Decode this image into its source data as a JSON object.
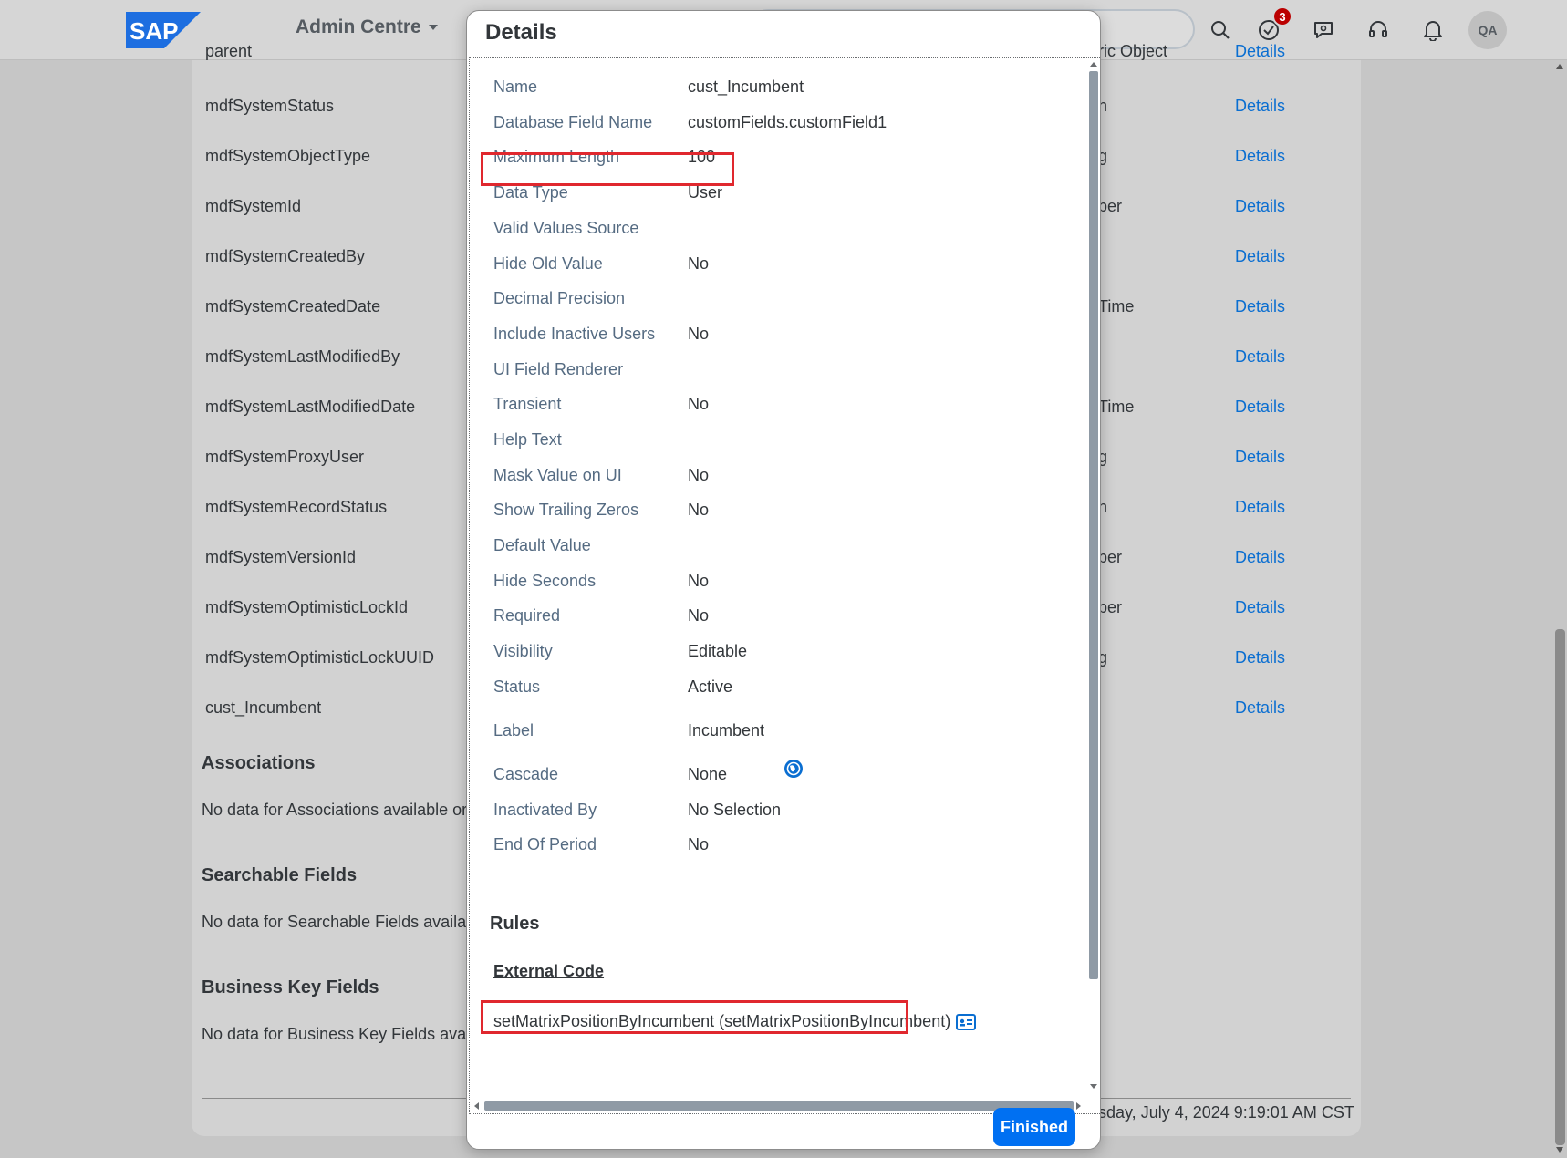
{
  "shell": {
    "logo_text": "SAP",
    "app_title": "Admin Centre",
    "notification_count": "3",
    "avatar_initials": "QA"
  },
  "background": {
    "partial_top_label": "parent",
    "partial_top_type": "ric Object",
    "fields": [
      {
        "name": "mdfSystemStatus",
        "type": "n",
        "link": "Details"
      },
      {
        "name": "mdfSystemObjectType",
        "type": "g",
        "link": "Details"
      },
      {
        "name": "mdfSystemId",
        "type": "ber",
        "link": "Details"
      },
      {
        "name": "mdfSystemCreatedBy",
        "type": "",
        "link": "Details"
      },
      {
        "name": "mdfSystemCreatedDate",
        "type": "Time",
        "link": "Details"
      },
      {
        "name": "mdfSystemLastModifiedBy",
        "type": "",
        "link": "Details"
      },
      {
        "name": "mdfSystemLastModifiedDate",
        "type": "Time",
        "link": "Details"
      },
      {
        "name": "mdfSystemProxyUser",
        "type": "g",
        "link": "Details"
      },
      {
        "name": "mdfSystemRecordStatus",
        "type": "n",
        "link": "Details"
      },
      {
        "name": "mdfSystemVersionId",
        "type": "ber",
        "link": "Details"
      },
      {
        "name": "mdfSystemOptimisticLockId",
        "type": "ber",
        "link": "Details"
      },
      {
        "name": "mdfSystemOptimisticLockUUID",
        "type": "g",
        "link": "Details"
      },
      {
        "name": "cust_Incumbent",
        "type": "",
        "link": "Details"
      }
    ],
    "sections": [
      {
        "title": "Associations",
        "text": "No data for Associations available or y"
      },
      {
        "title": "Searchable Fields",
        "text": "No data for Searchable Fields availab"
      },
      {
        "title": "Business Key Fields",
        "text": "No data for Business Key Fields availa"
      }
    ],
    "footer_text": "sday, July 4, 2024 9:19:01 AM CST"
  },
  "dialog": {
    "title": "Details",
    "properties": [
      {
        "label": "Name",
        "value": "cust_Incumbent"
      },
      {
        "label": "Database Field Name",
        "value": "customFields.customField1"
      },
      {
        "label": "Maximum Length",
        "value": "100"
      },
      {
        "label": "Data Type",
        "value": "User"
      },
      {
        "label": "Valid Values Source",
        "value": ""
      },
      {
        "label": "Hide Old Value",
        "value": "No"
      },
      {
        "label": "Decimal Precision",
        "value": ""
      },
      {
        "label": "Include Inactive Users",
        "value": "No"
      },
      {
        "label": "UI Field Renderer",
        "value": ""
      },
      {
        "label": "Transient",
        "value": "No"
      },
      {
        "label": "Help Text",
        "value": ""
      },
      {
        "label": "Mask Value on UI",
        "value": "No"
      },
      {
        "label": "Show Trailing Zeros",
        "value": "No"
      },
      {
        "label": "Default Value",
        "value": ""
      },
      {
        "label": "Hide Seconds",
        "value": "No"
      },
      {
        "label": "Required",
        "value": "No"
      },
      {
        "label": "Visibility",
        "value": "Editable"
      },
      {
        "label": "Status",
        "value": "Active"
      },
      {
        "label": "Label",
        "value": "Incumbent"
      },
      {
        "label": "Cascade",
        "value": "None"
      },
      {
        "label": "Inactivated By",
        "value": "No Selection"
      },
      {
        "label": "End Of Period",
        "value": "No"
      }
    ],
    "rules_title": "Rules",
    "rules_column": "External Code",
    "rule_value": "setMatrixPositionByIncumbent (setMatrixPositionByIncumbent)",
    "finish_label": "Finished"
  },
  "colors": {
    "accent": "#0070f2",
    "link": "#0a6ed1",
    "highlight": "#e0282e",
    "badge": "#bb0000"
  }
}
